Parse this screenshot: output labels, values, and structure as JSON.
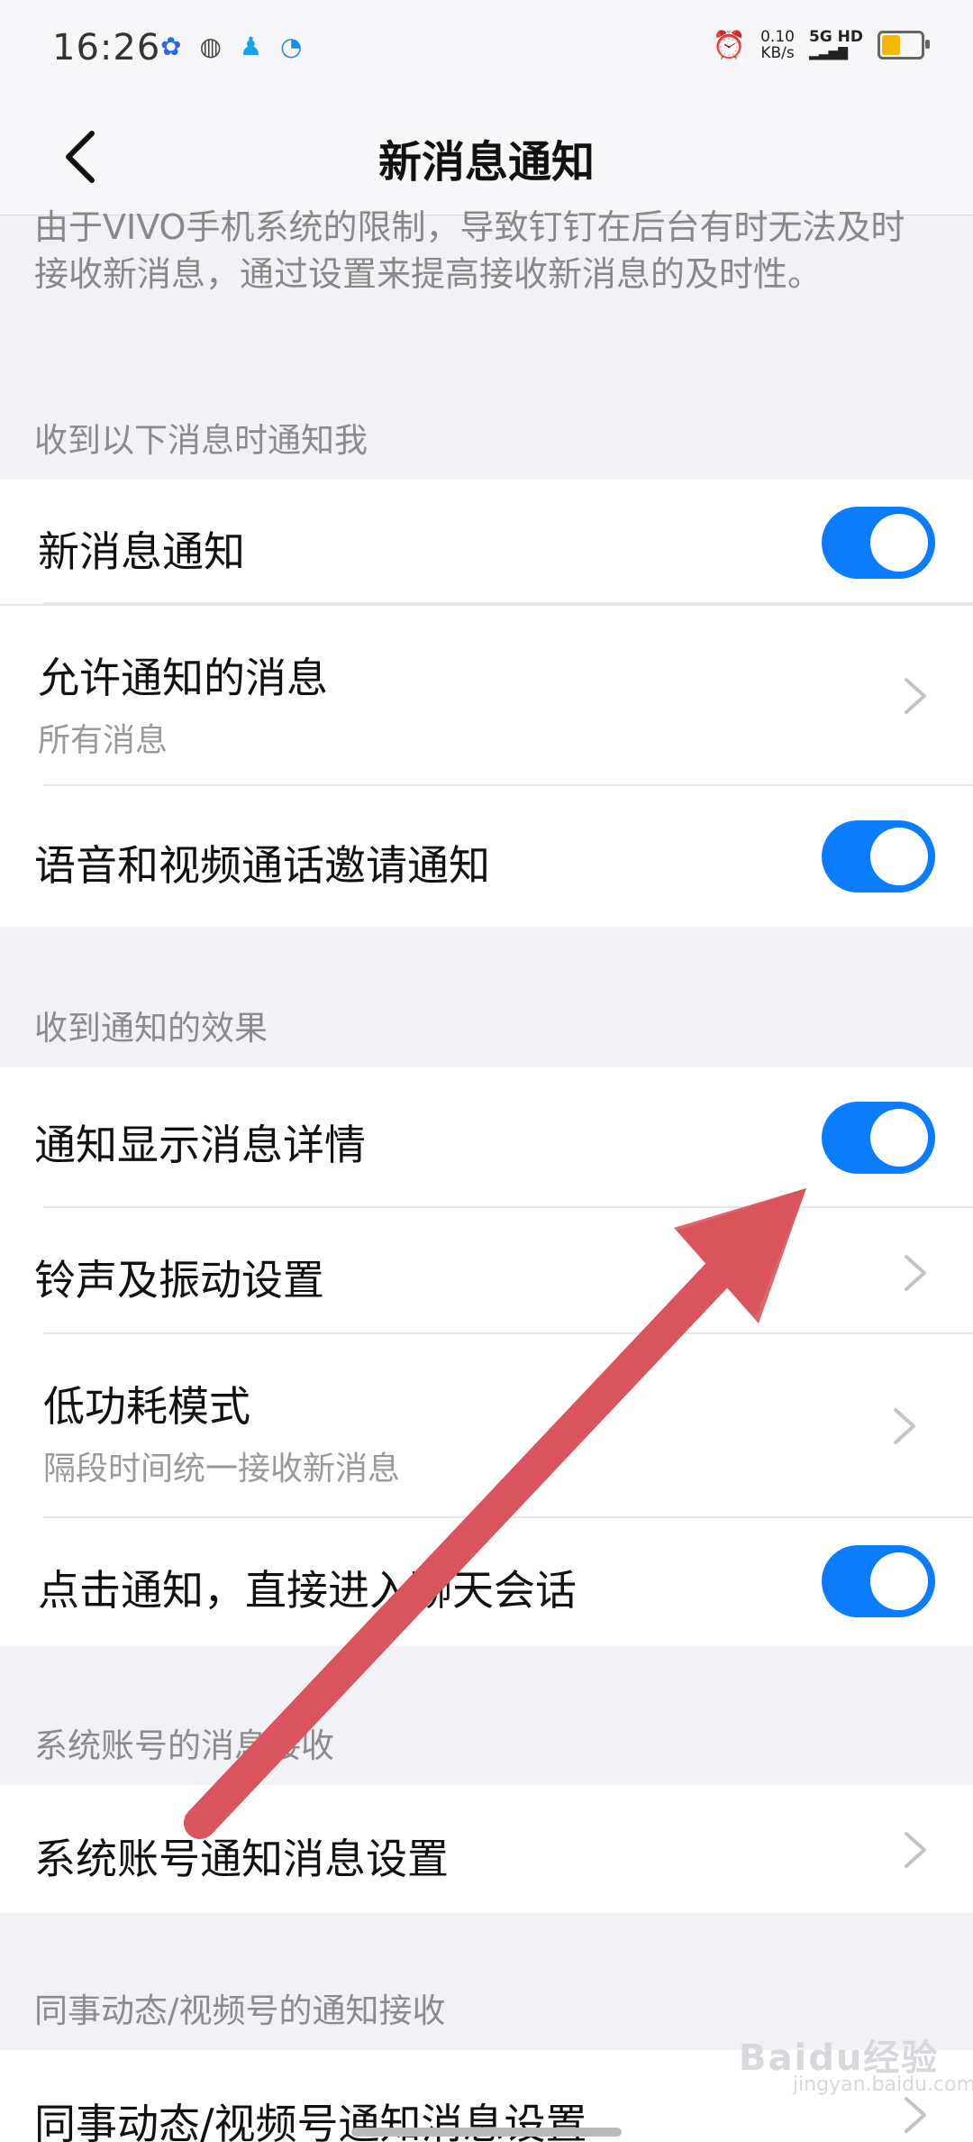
{
  "status_bar": {
    "time": "16:26",
    "app_icons": [
      "baidu-icon",
      "wechat-icon",
      "qq-icon",
      "browser-icon"
    ],
    "net_speed_value": "0.10",
    "net_speed_unit": "KB/s",
    "network": "5G HD",
    "battery_color": "#f5b800"
  },
  "header": {
    "title": "新消息通知"
  },
  "intro_text": "由于VIVO手机系统的限制，导致钉钉在后台有时无法及时接收新消息，通过设置来提高接收新消息的及时性。",
  "sections": {
    "notify_me": {
      "header": "收到以下消息时通知我",
      "new_message": {
        "label": "新消息通知",
        "enabled": true
      },
      "allowed_messages": {
        "label": "允许通知的消息",
        "value": "所有消息"
      },
      "call_invite": {
        "label": "语音和视频通话邀请通知",
        "enabled": true
      }
    },
    "effects": {
      "header": "收到通知的效果",
      "show_details": {
        "label": "通知显示消息详情",
        "enabled": true
      },
      "ringtone": {
        "label": "铃声及振动设置"
      },
      "low_power": {
        "label": "低功耗模式",
        "value": "隔段时间统一接收新消息"
      },
      "tap_to_chat": {
        "label": "点击通知，直接进入聊天会话",
        "enabled": true
      }
    },
    "system_account": {
      "header": "系统账号的消息接收",
      "settings": {
        "label": "系统账号通知消息设置"
      }
    },
    "colleague": {
      "header": "同事动态/视频号的通知接收",
      "settings": {
        "label": "同事动态/视频号通知消息设置"
      }
    }
  },
  "watermark": {
    "main": "Baidu经验",
    "sub": "jingyan.baidu.com"
  },
  "colors": {
    "accent": "#0a7cff",
    "arrow": "#d9545c"
  }
}
